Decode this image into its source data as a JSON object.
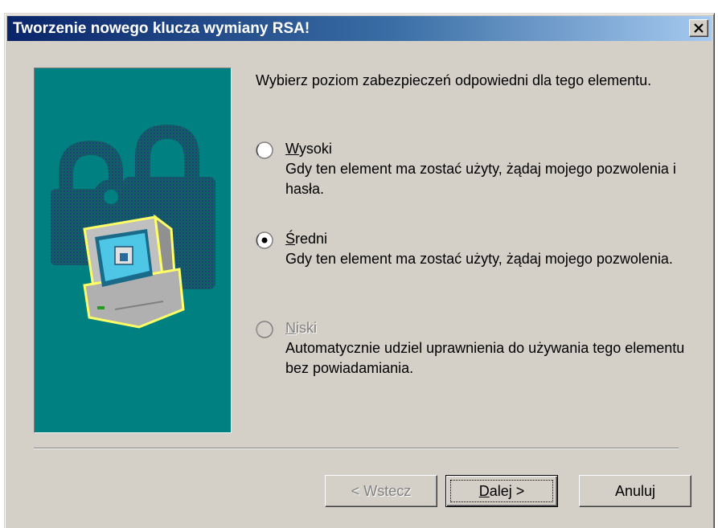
{
  "window": {
    "title": "Tworzenie nowego klucza wymiany RSA!",
    "close_glyph": "×",
    "close_icon": "close-icon"
  },
  "picture": {
    "icon": "computer-lock-illustration",
    "background_color": "#008080"
  },
  "prompt": "Wybierz poziom zabezpieczeń odpowiedni dla tego elementu.",
  "options": [
    {
      "label_first": "W",
      "label_rest": "ysoki",
      "description": "Gdy ten element ma zostać użyty, żądaj mojego pozwolenia i hasła.",
      "selected": false,
      "enabled": true
    },
    {
      "label_first": "Ś",
      "label_rest": "redni",
      "description": "Gdy ten element ma zostać użyty, żądaj mojego pozwolenia.",
      "selected": true,
      "enabled": true
    },
    {
      "label_first": "N",
      "label_rest": "iski",
      "description": "Automatycznie udziel uprawnienia do używania tego elementu bez powiadamiania.",
      "selected": false,
      "enabled": false
    }
  ],
  "buttons": {
    "back": "< Wstecz",
    "next_first": "D",
    "next_rest": "alej >",
    "cancel": "Anuluj"
  },
  "colors": {
    "title_gradient_start": "#0a246a",
    "title_gradient_end": "#a6caf0",
    "face": "#d4d0c8",
    "picture_bg": "#008080"
  }
}
